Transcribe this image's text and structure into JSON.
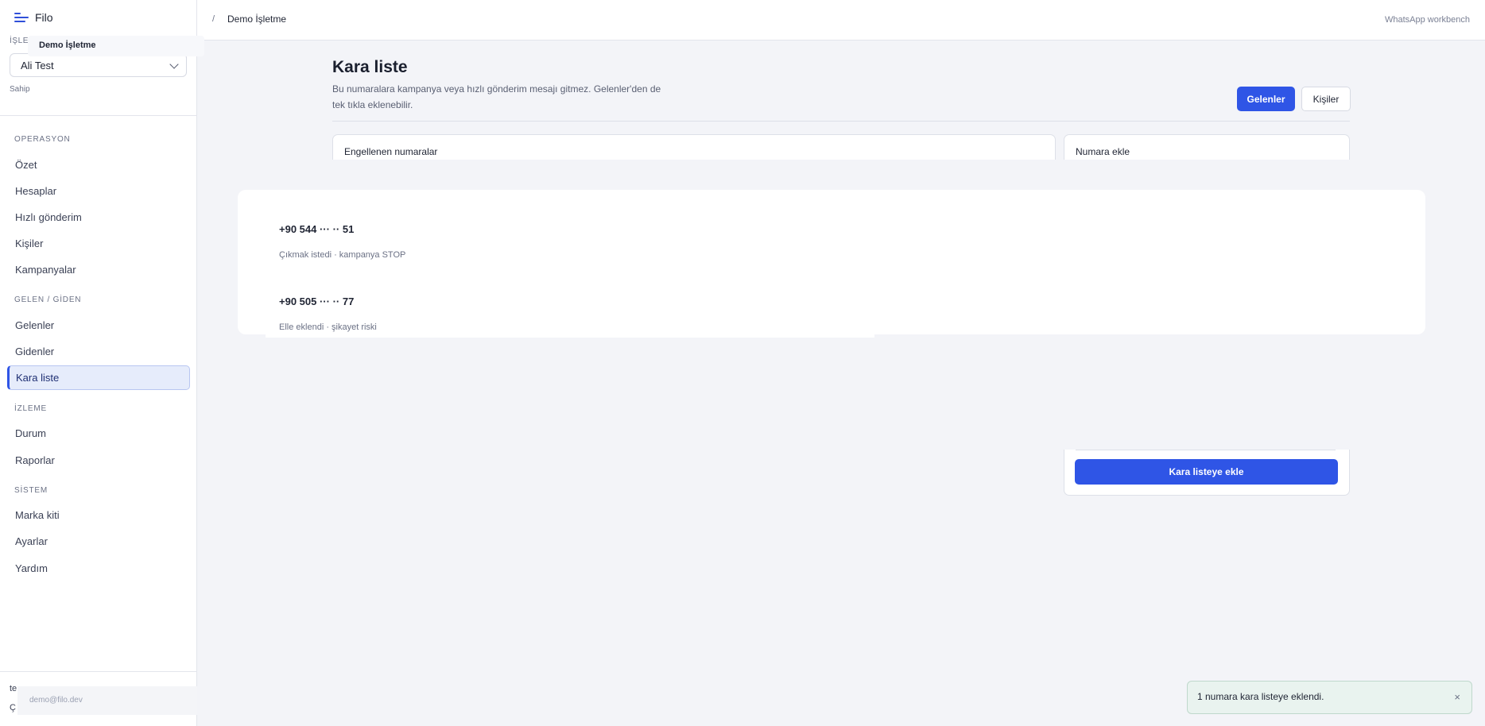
{
  "app": {
    "name": "Filo"
  },
  "sidebar": {
    "workspace_label": "İŞLET",
    "workspace_popup": "Demo İşletme",
    "workspace_select": "Ali Test",
    "role": "Sahip",
    "sections": [
      {
        "label": "OPERASYON",
        "items": [
          "Özet",
          "Hesaplar",
          "Hızlı gönderim",
          "Kişiler",
          "Kampanyalar"
        ]
      },
      {
        "label": "GELEN / GİDEN",
        "items": [
          "Gelenler",
          "Gidenler",
          "Kara liste"
        ]
      },
      {
        "label": "İZLEME",
        "items": [
          "Durum",
          "Raporlar"
        ]
      },
      {
        "label": "SİSTEM",
        "items": [
          "Marka kiti",
          "Ayarlar",
          "Yardım"
        ]
      }
    ],
    "active_item": "Kara liste",
    "bottom_peek_1": "te",
    "bottom_peek_2": "Ç",
    "email": "demo@filo.dev"
  },
  "topbar": {
    "separator": "/",
    "breadcrumb": "Demo İşletme",
    "right_label": "WhatsApp workbench"
  },
  "page": {
    "title": "Kara liste",
    "description": "Bu numaralara kampanya veya hızlı gönderim mesajı gitmez. Gelenler'den de tek tıkla eklenebilir.",
    "btn_primary": "Gelenler",
    "btn_secondary": "Kişiler"
  },
  "blocked_card": {
    "title": "Engellenen numaralar",
    "rows": [
      {
        "number": "+90 544 ··· ·· 51",
        "note": "Çıkmak istedi · kampanya STOP"
      },
      {
        "number": "+90 505 ··· ·· 77",
        "note": "Elle eklendi · şikayet riski"
      }
    ]
  },
  "add_card": {
    "title": "Numara ekle",
    "submit": "Kara listeye ekle"
  },
  "toast": {
    "message": "1 numara kara listeye eklendi.",
    "close": "×"
  },
  "colors": {
    "accent": "#2f55e6",
    "toast_bg": "#e9f3ef"
  }
}
